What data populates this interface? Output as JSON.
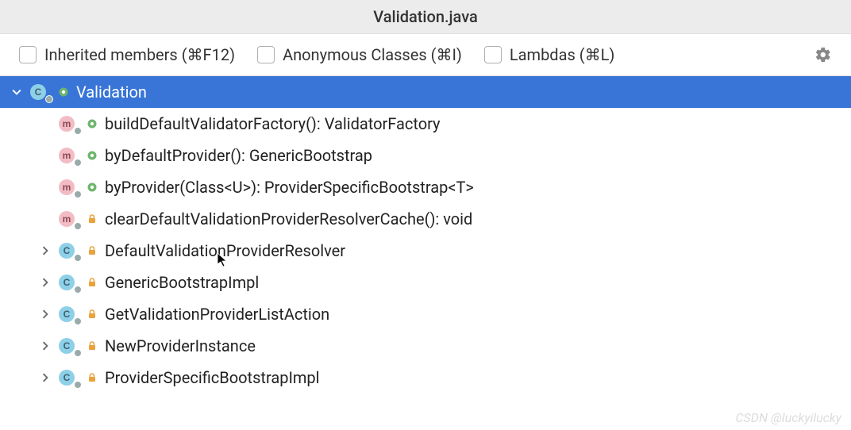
{
  "title": "Validation.java",
  "toolbar": {
    "inherited": "Inherited members (⌘F12)",
    "anonymous": "Anonymous Classes (⌘I)",
    "lambdas": "Lambdas (⌘L)"
  },
  "tree": {
    "root": {
      "label": "Validation",
      "kind": "class",
      "access": "public",
      "expanded": true,
      "selected": true
    },
    "children": [
      {
        "label": "buildDefaultValidatorFactory(): ValidatorFactory",
        "kind": "method",
        "access": "public",
        "expandable": false
      },
      {
        "label": "byDefaultProvider(): GenericBootstrap",
        "kind": "method",
        "access": "public",
        "expandable": false
      },
      {
        "label": "byProvider(Class<U>): ProviderSpecificBootstrap<T>",
        "kind": "method",
        "access": "public",
        "expandable": false
      },
      {
        "label": "clearDefaultValidationProviderResolverCache(): void",
        "kind": "method",
        "access": "private",
        "expandable": false
      },
      {
        "label": "DefaultValidationProviderResolver",
        "kind": "class",
        "access": "private",
        "expandable": true
      },
      {
        "label": "GenericBootstrapImpl",
        "kind": "class",
        "access": "private",
        "expandable": true
      },
      {
        "label": "GetValidationProviderListAction",
        "kind": "class",
        "access": "private",
        "expandable": true
      },
      {
        "label": "NewProviderInstance",
        "kind": "class",
        "access": "private",
        "expandable": true
      },
      {
        "label": "ProviderSpecificBootstrapImpl",
        "kind": "class",
        "access": "private",
        "expandable": true
      }
    ]
  },
  "watermark": "CSDN @luckyilucky"
}
